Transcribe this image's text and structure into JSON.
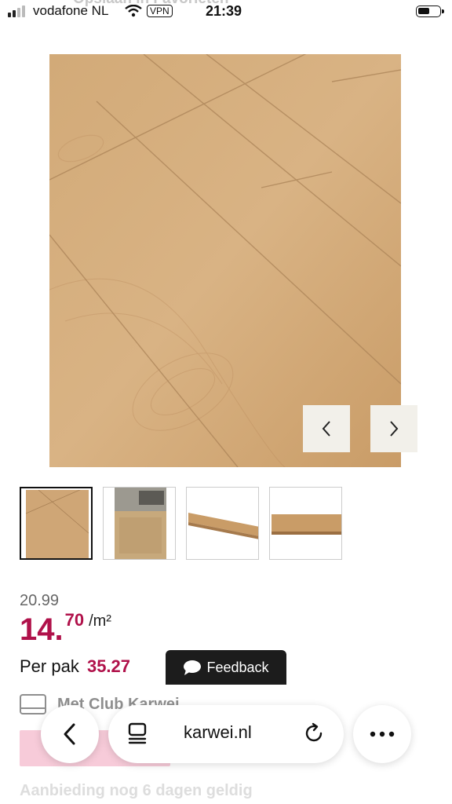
{
  "status_bar": {
    "carrier": "vodafone NL",
    "vpn": "VPN",
    "time": "21:39"
  },
  "header_ghost": {
    "favorites_label": "Opslaan in Favorieten"
  },
  "gallery": {
    "main_image_icon": "wood-floor-image",
    "prev_icon": "chevron-left-icon",
    "next_icon": "chevron-right-icon",
    "thumbnails": [
      "wood-plank-closeup",
      "room-with-floor",
      "single-plank-angle",
      "single-plank-side"
    ]
  },
  "pricing": {
    "old_price": "20.99",
    "price_int": "14.",
    "price_dec": "70",
    "price_unit": "/m²",
    "per_pak_label": "Per pak",
    "per_pak_amount": "35.27",
    "accent_color": "#b0114a"
  },
  "feedback": {
    "label": "Feedback",
    "icon": "speech-bubble-icon"
  },
  "club": {
    "label": "Met Club Karwei",
    "icon": "card-icon"
  },
  "promo": {
    "validity_text": "Aanbieding nog 6 dagen geldig"
  },
  "browser_bar": {
    "url": "karwei.nl",
    "back_icon": "chevron-left-icon",
    "tabs_icon": "tabs-icon",
    "reload_icon": "reload-icon",
    "more_icon": "more-dots-icon"
  }
}
